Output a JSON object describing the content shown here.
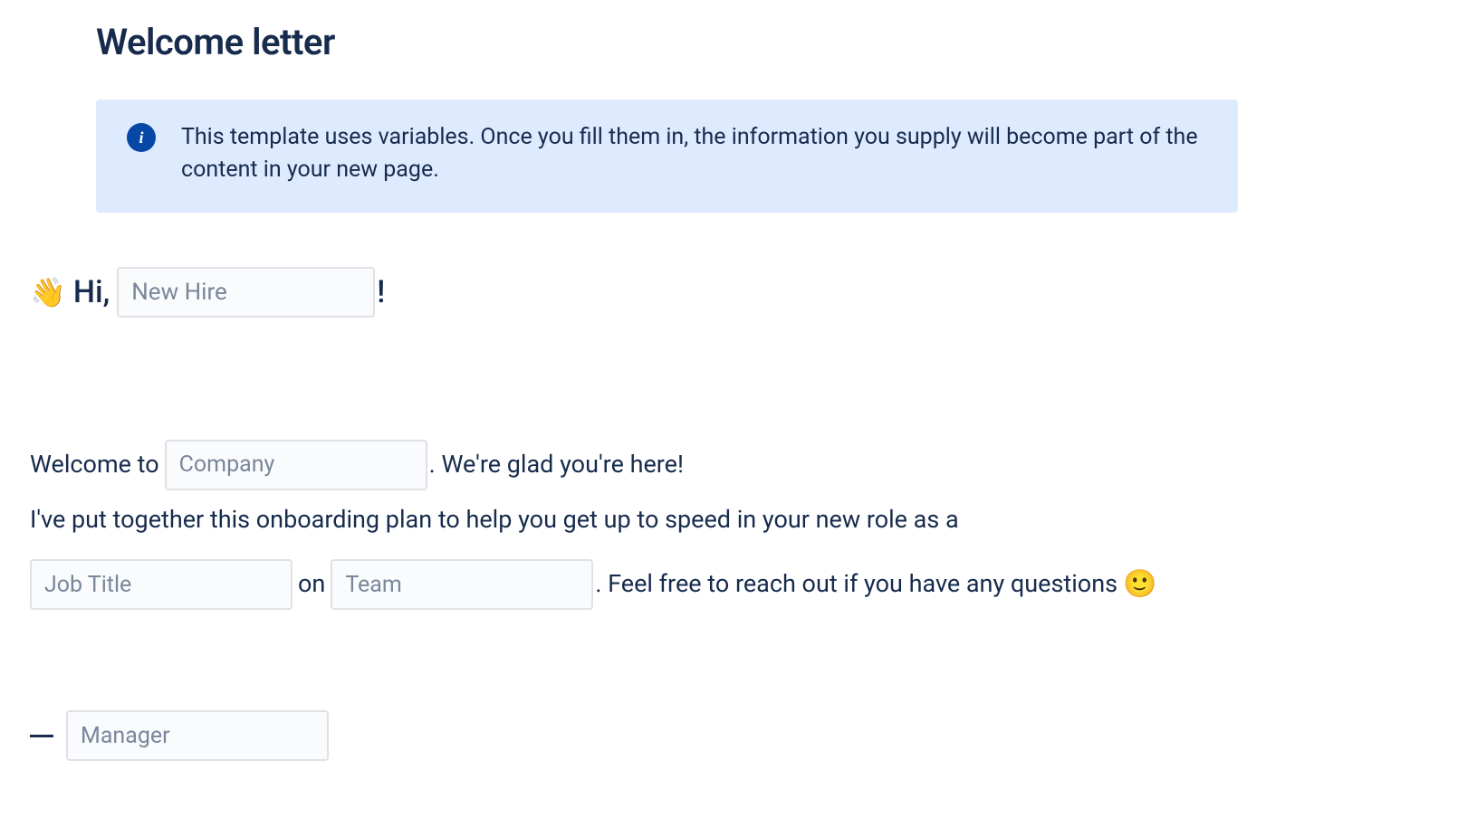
{
  "title": "Welcome letter",
  "info_panel": {
    "icon_label": "i",
    "text": "This template uses variables. Once you fill them in, the information you supply will become part of the content in your new page."
  },
  "greeting": {
    "wave_emoji": "👋",
    "hi_text": "Hi,",
    "new_hire_placeholder": "New Hire",
    "exclaim": "!"
  },
  "body": {
    "welcome_to": "Welcome to",
    "company_placeholder": "Company",
    "glad_text": ". We're glad you're here!",
    "onboarding_text": "I've put together this onboarding plan to help you get up to speed in your new role as a",
    "job_title_placeholder": "Job Title",
    "on_text": "on",
    "team_placeholder": "Team",
    "feel_free_text": ". Feel free to reach out if you have any questions",
    "smile_emoji": "🙂"
  },
  "signature": {
    "manager_placeholder": "Manager"
  }
}
